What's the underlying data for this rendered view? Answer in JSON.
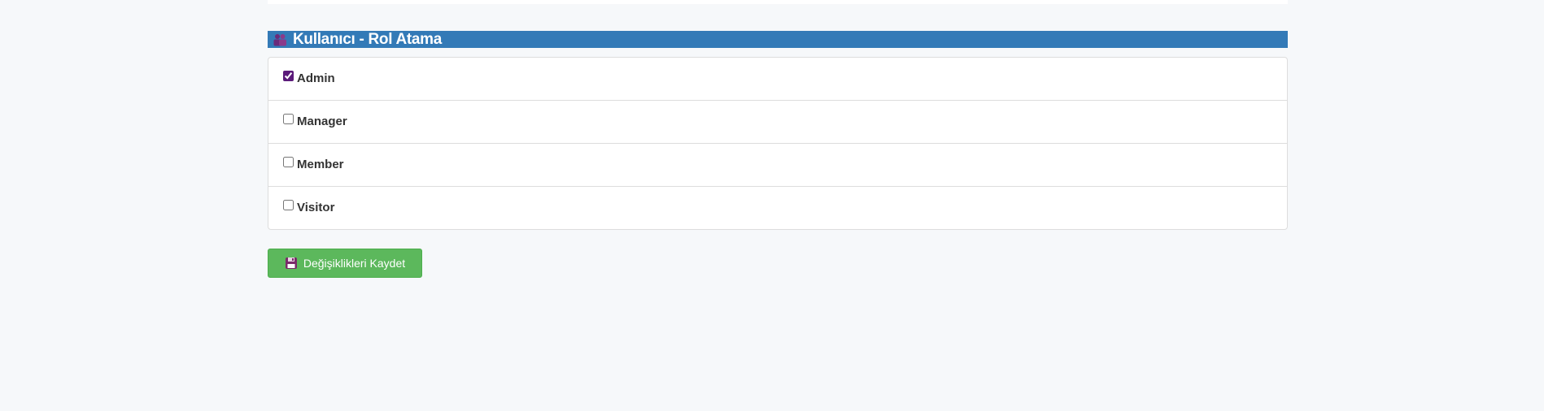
{
  "header": {
    "title": "Kullanıcı - Rol Atama",
    "icon": "users-icon"
  },
  "roles": [
    {
      "label": "Admin",
      "checked": true
    },
    {
      "label": "Manager",
      "checked": false
    },
    {
      "label": "Member",
      "checked": false
    },
    {
      "label": "Visitor",
      "checked": false
    }
  ],
  "save_button": {
    "label": "Değişiklikleri Kaydet",
    "icon": "floppy-disk-icon"
  },
  "colors": {
    "header_bg": "#337ab7",
    "button_bg": "#5cb85c",
    "page_bg": "#f6f8fa"
  }
}
